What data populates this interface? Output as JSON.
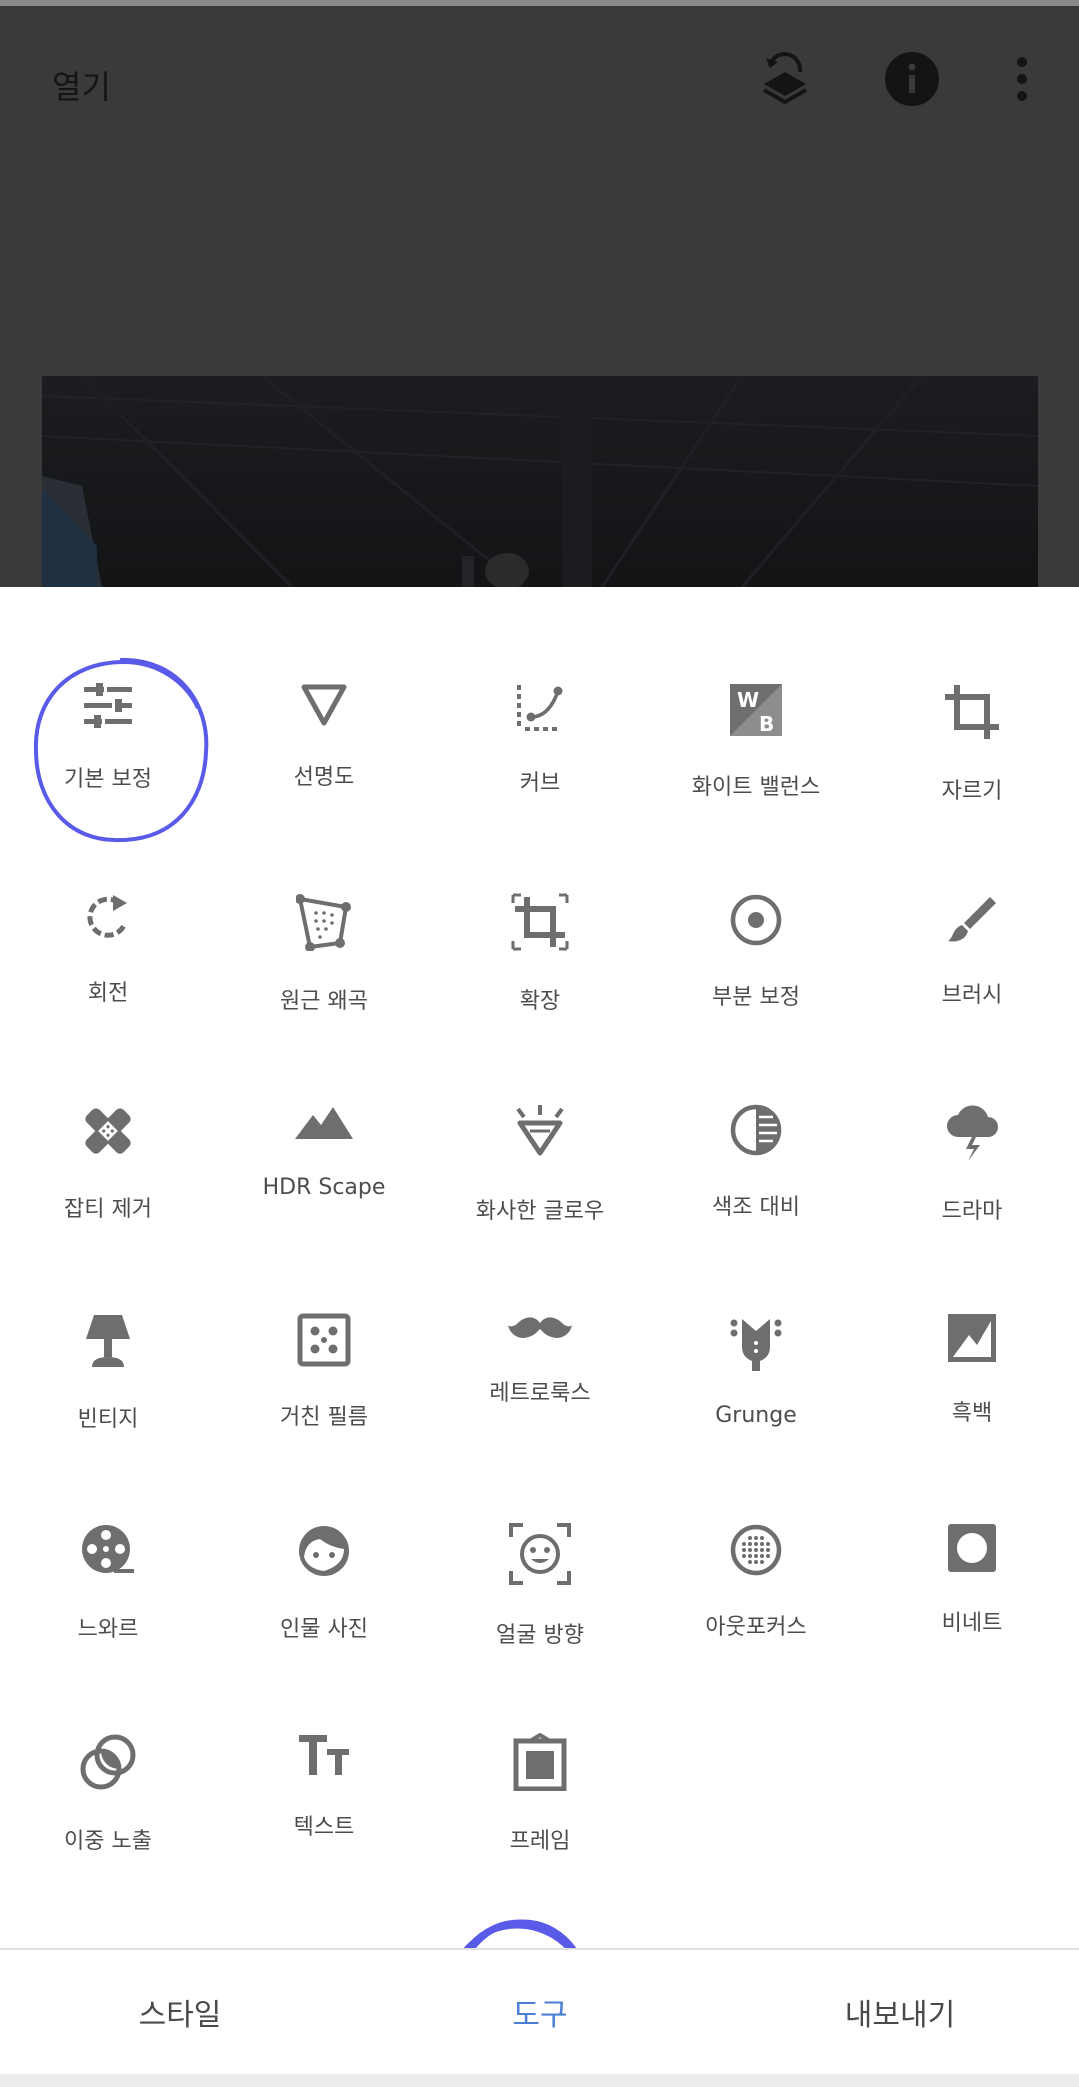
{
  "topbar": {
    "open_label": "열기",
    "icons": [
      "layers-undo-icon",
      "info-icon",
      "more-vert-icon"
    ]
  },
  "tools": [
    {
      "label": "기본 보정",
      "icon": "tune-icon"
    },
    {
      "label": "선명도",
      "icon": "triangle-down-icon"
    },
    {
      "label": "커브",
      "icon": "curves-icon"
    },
    {
      "label": "화이트 밸런스",
      "icon": "white-balance-icon"
    },
    {
      "label": "자르기",
      "icon": "crop-icon"
    },
    {
      "label": "회전",
      "icon": "rotate-icon"
    },
    {
      "label": "원근 왜곡",
      "icon": "perspective-icon"
    },
    {
      "label": "확장",
      "icon": "expand-icon"
    },
    {
      "label": "부분 보정",
      "icon": "selective-icon"
    },
    {
      "label": "브러시",
      "icon": "brush-icon"
    },
    {
      "label": "잡티 제거",
      "icon": "healing-icon"
    },
    {
      "label": "HDR Scape",
      "icon": "mountain-icon"
    },
    {
      "label": "화사한 글로우",
      "icon": "diamond-glow-icon"
    },
    {
      "label": "색조 대비",
      "icon": "tonal-contrast-icon"
    },
    {
      "label": "드라마",
      "icon": "storm-cloud-icon"
    },
    {
      "label": "빈티지",
      "icon": "lamp-icon"
    },
    {
      "label": "거친 필름",
      "icon": "dice-icon"
    },
    {
      "label": "레트로룩스",
      "icon": "mustache-icon"
    },
    {
      "label": "Grunge",
      "icon": "guitar-icon"
    },
    {
      "label": "흑백",
      "icon": "black-white-icon"
    },
    {
      "label": "느와르",
      "icon": "film-reel-icon"
    },
    {
      "label": "인물 사진",
      "icon": "face-icon"
    },
    {
      "label": "얼굴 방향",
      "icon": "face-pose-icon"
    },
    {
      "label": "아웃포커스",
      "icon": "lens-blur-icon"
    },
    {
      "label": "비네트",
      "icon": "vignette-icon"
    },
    {
      "label": "이중 노출",
      "icon": "double-exposure-icon"
    },
    {
      "label": "텍스트",
      "icon": "text-icon"
    },
    {
      "label": "프레임",
      "icon": "frame-icon"
    }
  ],
  "bottom_nav": {
    "styles_label": "스타일",
    "tools_label": "도구",
    "export_label": "내보내기",
    "active": "tools"
  },
  "colors": {
    "icon": "#6e6e6e",
    "label": "#4d4d4d",
    "active_tab": "#4a7fd4",
    "annotation": "#5a5ae8",
    "top_overlay": "#3a3a3a"
  }
}
